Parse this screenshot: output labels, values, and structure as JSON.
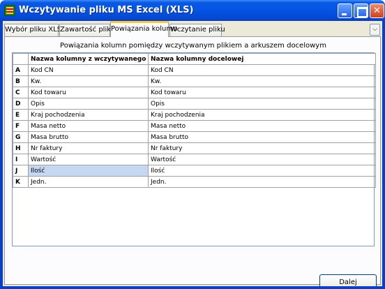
{
  "window": {
    "title": "Wczytywanie pliku MS Excel (XLS)",
    "controls": {
      "minimize": "minimize",
      "maximize": "maximize",
      "close": "close"
    }
  },
  "tabs": [
    {
      "label": "Wybór pliku XLS",
      "active": false
    },
    {
      "label": "Zawartość pliku",
      "active": false
    },
    {
      "label": "Powiązania kolumn",
      "active": true
    },
    {
      "label": "Wczytanie pliku",
      "active": false
    }
  ],
  "panel": {
    "header": "Powiązania kolumn pomiędzy wczytywanym plikiem a arkuszem docelowym"
  },
  "table": {
    "columns": [
      "Nazwa kolumny z wczytywanego pliku",
      "Nazwa kolumny docelowej"
    ],
    "rows": [
      {
        "key": "A",
        "source": "Kod CN",
        "target": "Kod CN"
      },
      {
        "key": "B",
        "source": "Kw.",
        "target": "Kw."
      },
      {
        "key": "C",
        "source": "Kod towaru",
        "target": "Kod towaru"
      },
      {
        "key": "D",
        "source": "Opis",
        "target": "Opis"
      },
      {
        "key": "E",
        "source": "Kraj pochodzenia",
        "target": "Kraj pochodzenia"
      },
      {
        "key": "F",
        "source": "Masa netto",
        "target": "Masa netto"
      },
      {
        "key": "G",
        "source": "Masa brutto",
        "target": "Masa brutto"
      },
      {
        "key": "H",
        "source": "Nr faktury",
        "target": "Nr faktury"
      },
      {
        "key": "I",
        "source": "Wartość",
        "target": "Wartość"
      },
      {
        "key": "J",
        "source": "Ilość",
        "target": "Ilość",
        "selected": true
      },
      {
        "key": "K",
        "source": "Jedn.",
        "target": "Jedn."
      }
    ]
  },
  "footer": {
    "next_label": "Dalej"
  },
  "colors": {
    "titlebar": "#0554e3",
    "selection": "#c5d7f1",
    "tab_highlight": "#ffc83c"
  }
}
